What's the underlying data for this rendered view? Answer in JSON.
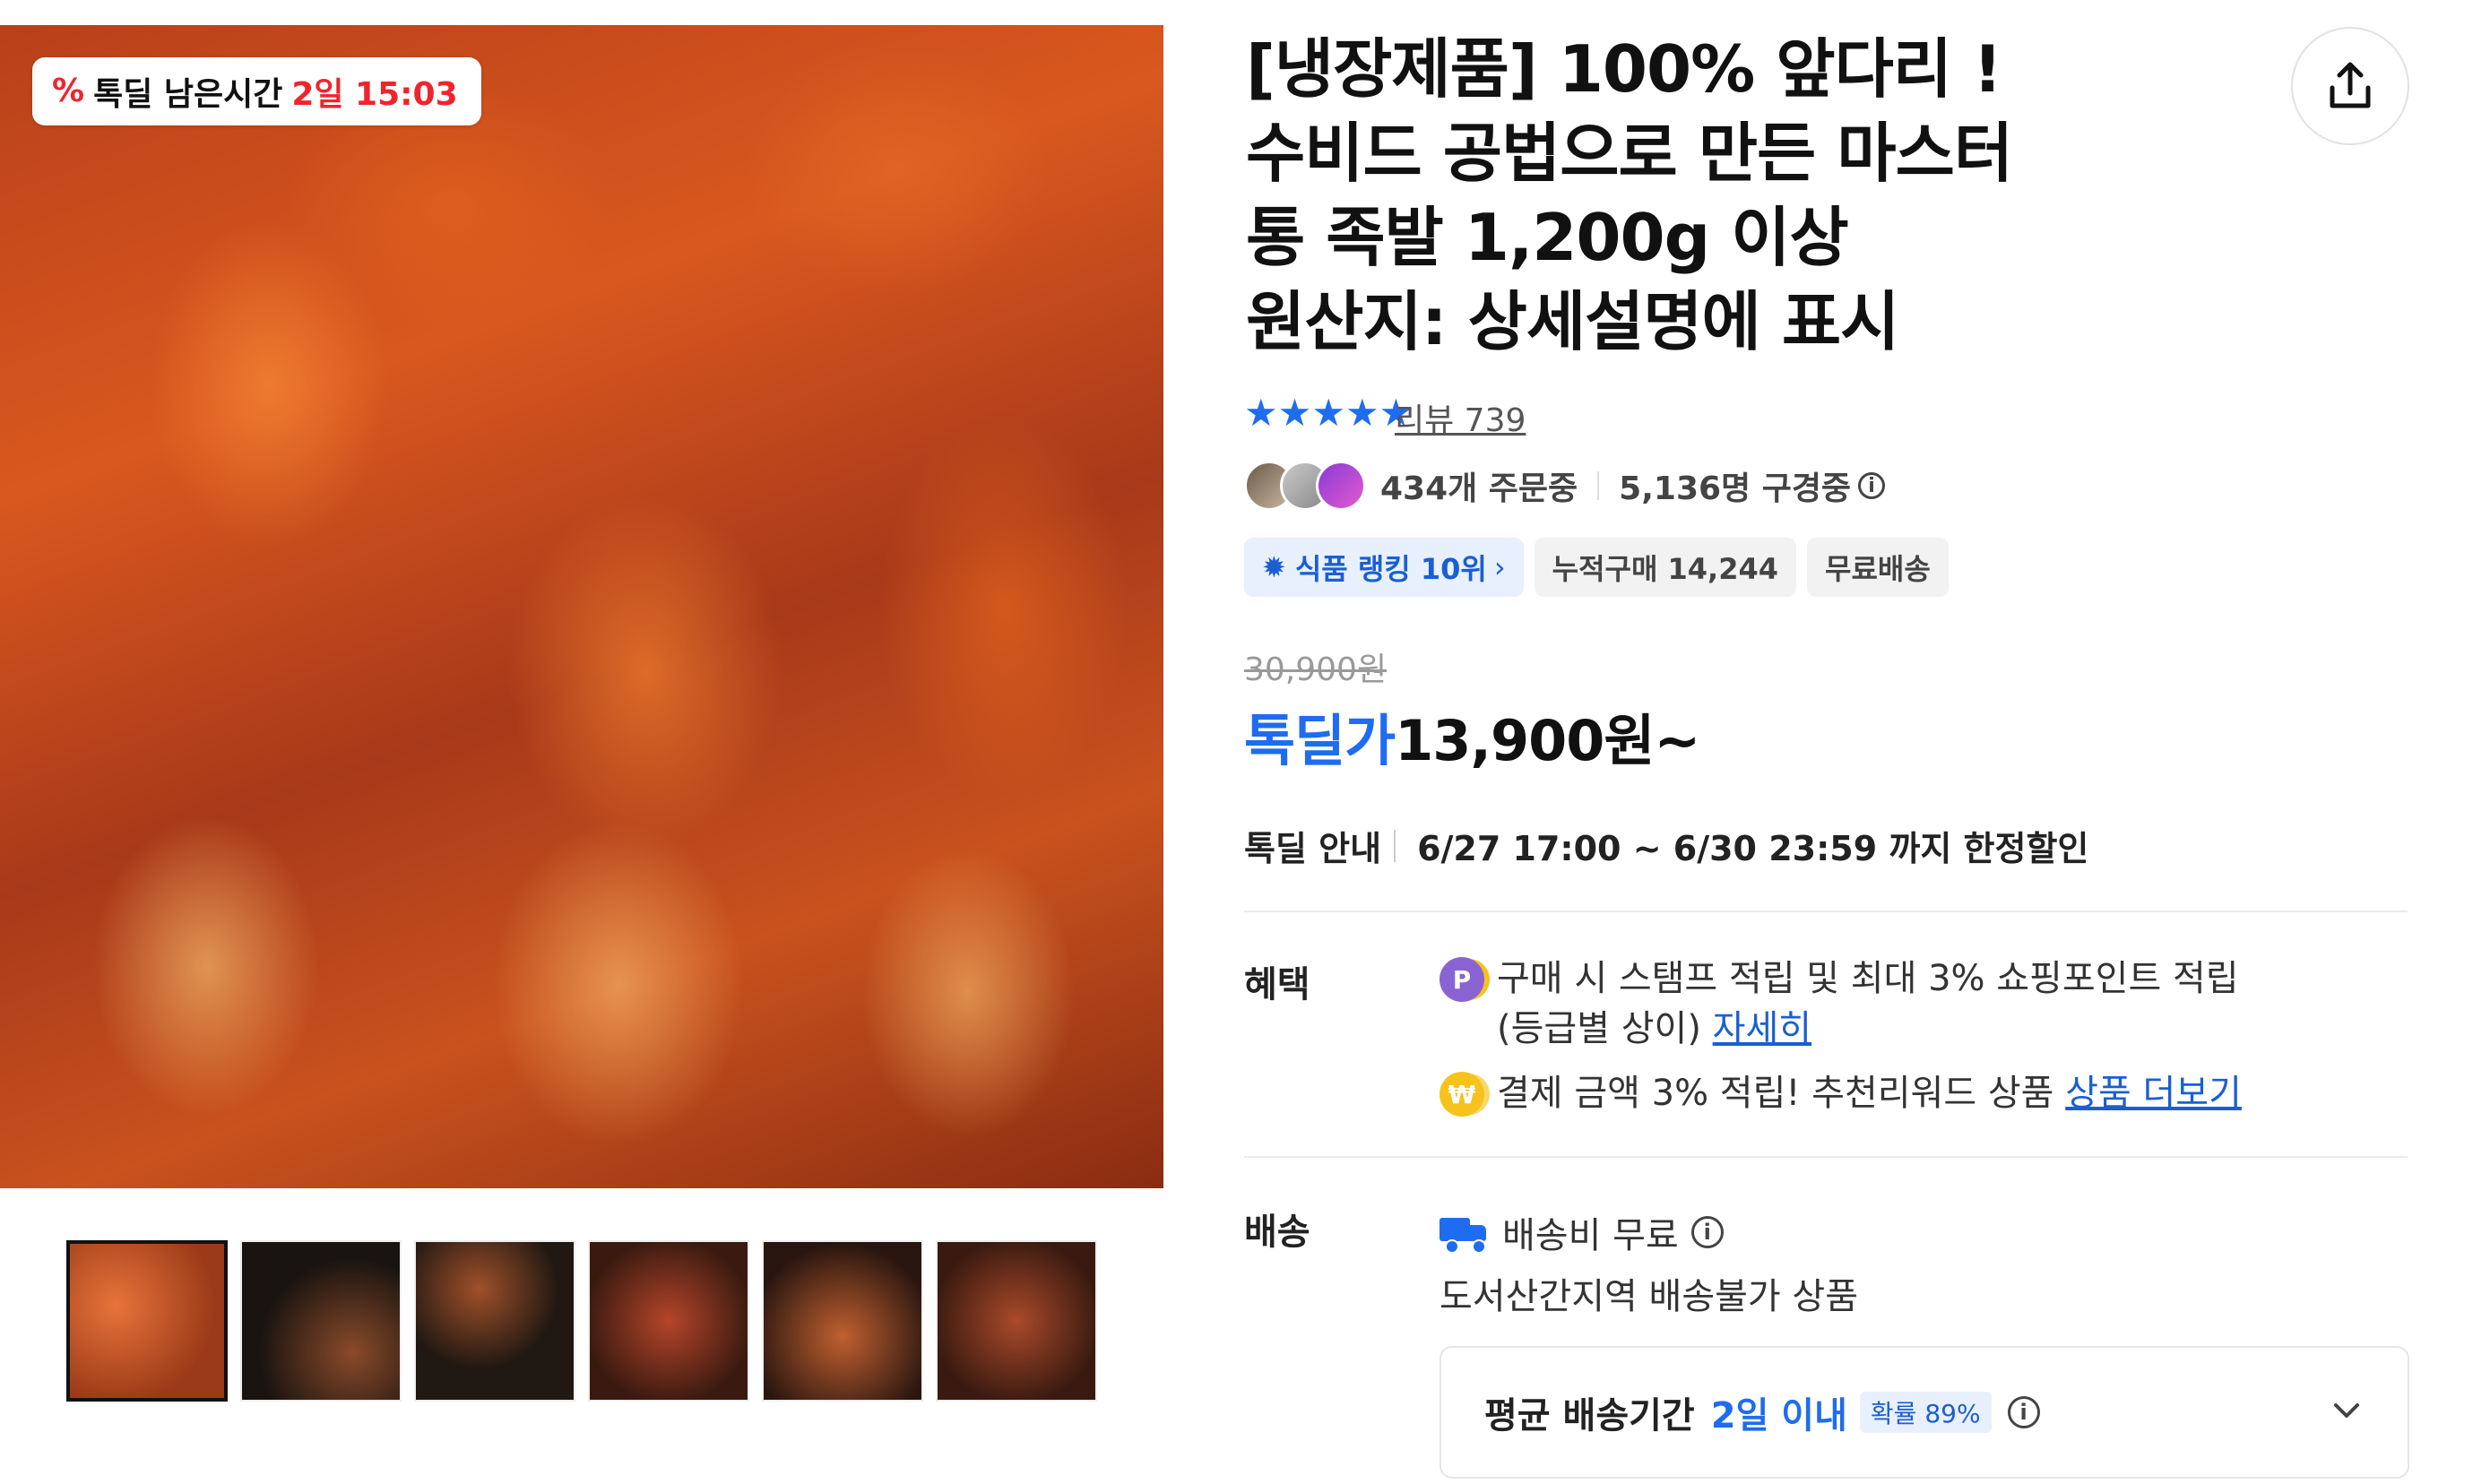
{
  "product": {
    "title_lines": [
      "[냉장제품] 100% 앞다리 !",
      "수비드 공법으로 만든 마스터",
      "통 족발 1,200g 이상",
      "원산지: 상세설명에 표시"
    ],
    "rating_stars": 5,
    "review_label": "리뷰 739",
    "orders_text": "434개 주문중",
    "viewers_text": "5,136명 구경중",
    "chips": {
      "ranking": "식품 랭킹 10위",
      "cumulative": "누적구매 14,244",
      "free_shipping": "무료배송"
    }
  },
  "gallery": {
    "timer_label": "톡딜 남은시간",
    "timer_value": "2일 15:03",
    "thumbnail_count": 6,
    "active_thumbnail": 0
  },
  "price": {
    "original": "30,900원",
    "deal_label": "톡딜가",
    "deal_price": "13,900원~"
  },
  "deal_info": {
    "label": "톡딜 안내",
    "text": "6/27 17:00 ~ 6/30 23:59 까지 한정할인"
  },
  "benefits": {
    "label": "혜택",
    "item1_line1": "구매 시 스탬프 적립 및 최대 3% 쇼핑포인트 적립",
    "item1_line2": "(등급별 상이)",
    "item1_link": "자세히",
    "item2_text": "결제 금액 3% 적립! 추천리워드 상품",
    "item2_link": "상품 더보기"
  },
  "shipping": {
    "label": "배송",
    "fee_text": "배송비 무료",
    "restriction": "도서산간지역 배송불가 상품",
    "avg_label": "평균 배송기간",
    "avg_days": "2일 이내",
    "probability": "확률 89%"
  },
  "colors": {
    "accent_blue": "#1f6cf0",
    "timer_red": "#f0242c"
  }
}
